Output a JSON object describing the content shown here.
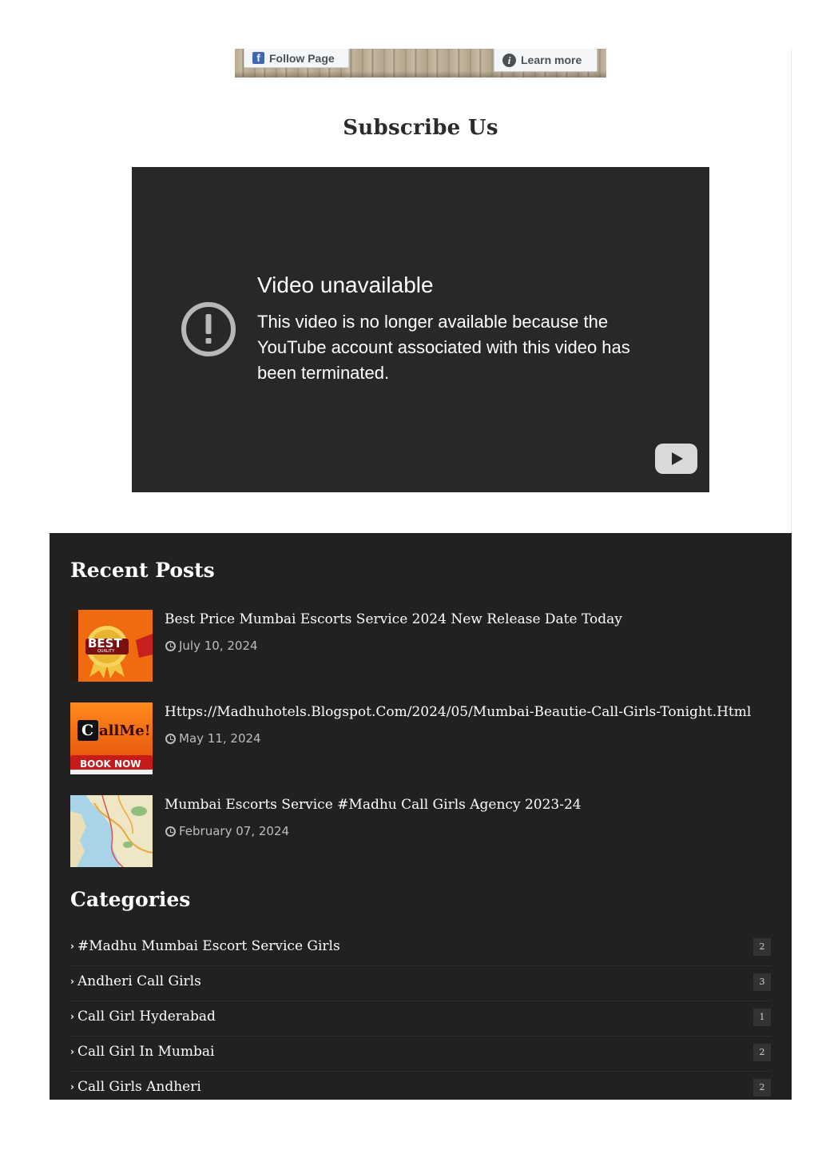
{
  "fb_plugin": {
    "follow_label": "Follow Page",
    "learn_label": "Learn more",
    "fb_logo": "f",
    "info_glyph": "i"
  },
  "subscribe": {
    "title": "Subscribe Us"
  },
  "video": {
    "title": "Video unavailable",
    "message": "This video is no longer available because the YouTube account associated with this video has been terminated."
  },
  "recent_posts": {
    "title": "Recent Posts",
    "items": [
      {
        "title": "Best Price Mumbai Escorts Service 2024 New Release Date Today",
        "date": "July 10, 2024",
        "thumb_text": "BEST",
        "thumb_sub": "QUALITY"
      },
      {
        "title": "Https://Madhuhotels.Blogspot.Com/2024/05/Mumbai-Beautie-Call-Girls-Tonight.Html",
        "date": "May 11, 2024",
        "thumb_text": "allMe!",
        "thumb_sub": "BOOK NOW"
      },
      {
        "title": "Mumbai Escorts Service #Madhu Call Girls Agency 2023-24",
        "date": "February 07, 2024"
      }
    ]
  },
  "categories": {
    "title": "Categories",
    "items": [
      {
        "label": "#Madhu Mumbai Escort Service Girls",
        "count": "2"
      },
      {
        "label": "Andheri Call Girls",
        "count": "3"
      },
      {
        "label": "Call Girl Hyderabad",
        "count": "1"
      },
      {
        "label": "Call Girl In Mumbai",
        "count": "2"
      },
      {
        "label": "Call Girls Andheri",
        "count": "2"
      }
    ]
  },
  "colors": {
    "dark_bg": "#212121",
    "video_bg": "#282828",
    "fb_blue": "#4267b2"
  }
}
